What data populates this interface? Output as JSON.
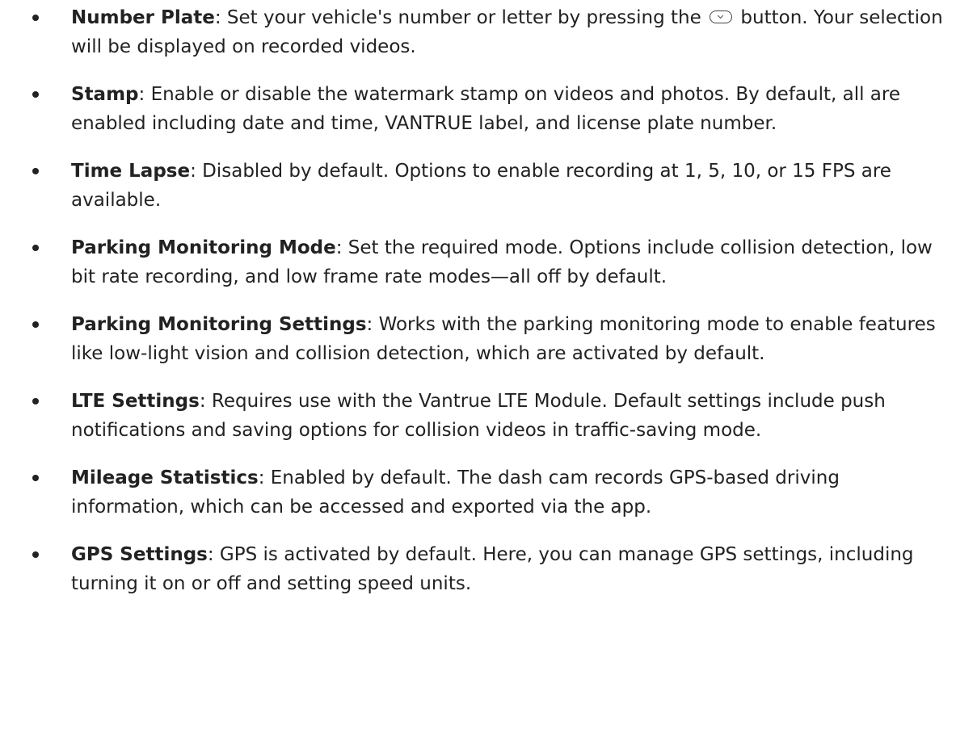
{
  "items": [
    {
      "term": "Number Plate",
      "sep": ":",
      "desc_before": " Set your vehicle's number or letter by pressing the ",
      "icon": "down-button-icon",
      "desc_after": " button. Your selection will be displayed on recorded videos."
    },
    {
      "term": "Stamp",
      "sep": ":",
      "desc": " Enable or disable the watermark stamp on videos and photos. By default, all are enabled including date and time, VANTRUE label, and license plate number."
    },
    {
      "term": "Time Lapse",
      "sep": ":",
      "desc": " Disabled by default. Options to enable recording at 1, 5, 10, or 15 FPS are available."
    },
    {
      "term": "Parking Monitoring Mode",
      "sep": ":",
      "desc": " Set the required mode. Options include collision detection, low bit rate recording, and low frame rate modes—all off by default."
    },
    {
      "term": "Parking Monitoring Settings",
      "sep": ":",
      "desc": " Works with the parking monitoring mode to enable features like low-light vision and collision detection, which are activated by default."
    },
    {
      "term": "LTE Settings",
      "sep": ":",
      "desc": " Requires use with the Vantrue LTE Module. Default settings include push notifications and saving options for collision videos in traffic-saving mode."
    },
    {
      "term": "Mileage Statistics",
      "sep": ":",
      "desc": " Enabled by default. The dash cam records GPS-based driving information, which can be accessed and exported via the app."
    },
    {
      "term": "GPS Settings",
      "sep": ":",
      "desc": " GPS is activated by default. Here, you can manage GPS settings, including turning it on or off and setting speed units."
    }
  ]
}
